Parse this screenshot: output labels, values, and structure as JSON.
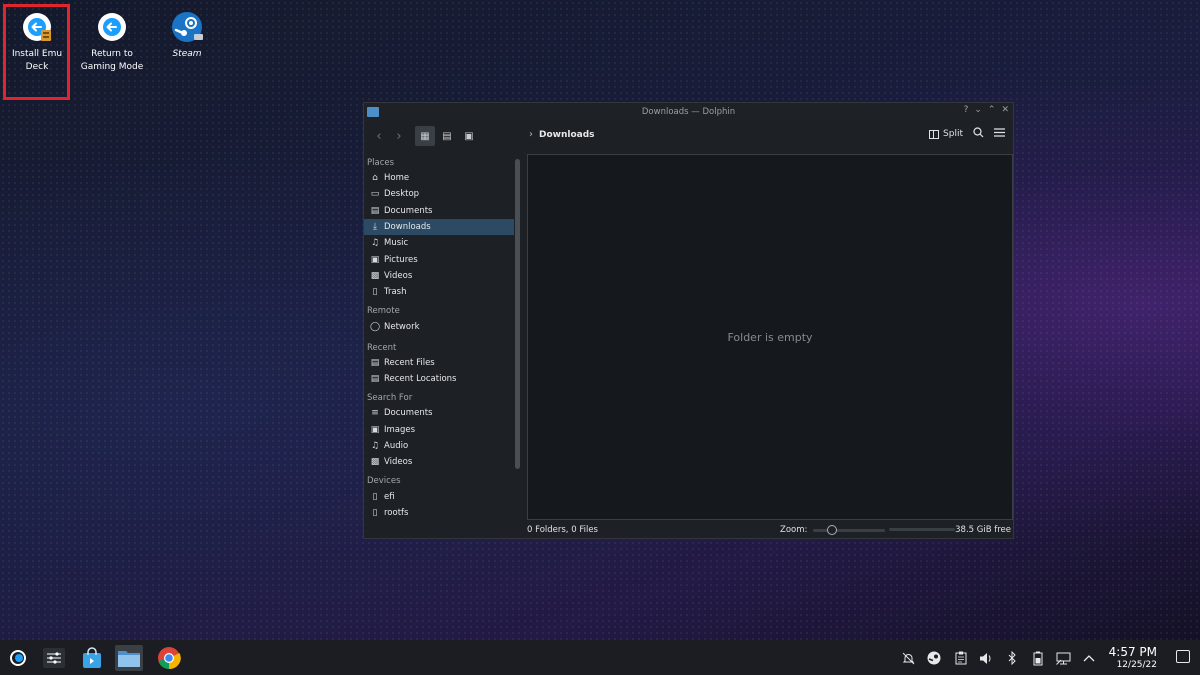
{
  "desktop": {
    "icons": [
      {
        "label": "Install Emu Deck"
      },
      {
        "label": "Return to Gaming Mode"
      },
      {
        "label": "Steam"
      }
    ]
  },
  "window": {
    "title": "Downloads — Dolphin",
    "breadcrumb": "Downloads",
    "split_label": "Split",
    "empty_message": "Folder is empty",
    "status_text": "0 Folders, 0 Files",
    "zoom_label": "Zoom:",
    "free_space": "38.5 GiB free"
  },
  "sidebar": {
    "sections": [
      {
        "title": "Places",
        "items": [
          "Home",
          "Desktop",
          "Documents",
          "Downloads",
          "Music",
          "Pictures",
          "Videos",
          "Trash"
        ]
      },
      {
        "title": "Remote",
        "items": [
          "Network"
        ]
      },
      {
        "title": "Recent",
        "items": [
          "Recent Files",
          "Recent Locations"
        ]
      },
      {
        "title": "Search For",
        "items": [
          "Documents",
          "Images",
          "Audio",
          "Videos"
        ]
      },
      {
        "title": "Devices",
        "items": [
          "efi",
          "rootfs"
        ]
      }
    ],
    "selected": "Downloads"
  },
  "taskbar": {
    "time": "4:57 PM",
    "date": "12/25/22"
  },
  "colors": {
    "highlight": "#e0252c",
    "selection": "#2c4a63",
    "accent": "#1a9fff"
  }
}
